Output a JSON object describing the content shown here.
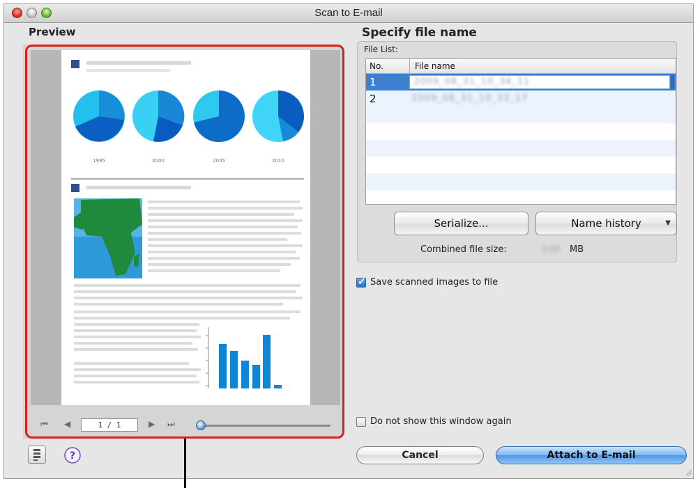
{
  "window": {
    "title": "Scan to E-mail"
  },
  "preview": {
    "heading": "Preview",
    "page_indicator": "1 / 1",
    "document": {
      "pie_years": [
        "1995",
        "2000",
        "2005",
        "2010"
      ]
    }
  },
  "file_panel": {
    "heading": "Specify file name",
    "file_list_label": "File List:",
    "columns": {
      "no": "No.",
      "file_name": "File name"
    },
    "rows": [
      {
        "no": "1",
        "file_name": "2009_08_31_10_34_11",
        "selected": true
      },
      {
        "no": "2",
        "file_name": "2009_08_31_10_33_17",
        "selected": false
      }
    ],
    "serialize_button": "Serialize...",
    "name_history_button": "Name history",
    "combined_size_label": "Combined file size:",
    "combined_size_value": "0.00",
    "combined_size_unit": "MB"
  },
  "options": {
    "save_scanned_label": "Save scanned images to file",
    "save_scanned_checked": true,
    "do_not_show_label": "Do not show this window again",
    "do_not_show_checked": false
  },
  "buttons": {
    "cancel": "Cancel",
    "attach": "Attach to E-mail"
  },
  "colors": {
    "highlight": "#e11b1b",
    "selection": "#3d7fd1",
    "primary_button": "#5fa3ea"
  }
}
